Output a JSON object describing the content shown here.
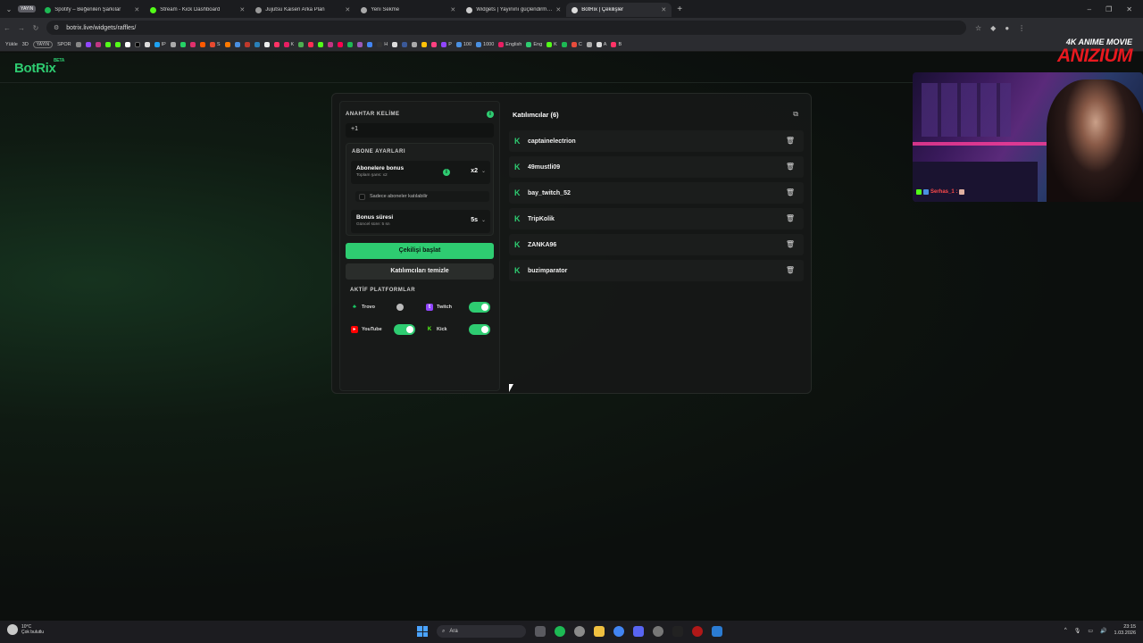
{
  "browser": {
    "tabs": [
      {
        "label": "Spotify – Beğenilen Şarkılar",
        "color": "#1db954",
        "active": false
      },
      {
        "label": "Stream - Kick Dashboard",
        "color": "#53fc18",
        "active": false
      },
      {
        "label": "Jujutsu Kaisen Arka Plan",
        "color": "#999999",
        "active": false
      },
      {
        "label": "Yeni Sekme",
        "color": "#aaaaaa",
        "active": false
      },
      {
        "label": "Widgets | Yayınını güçlendirmek",
        "color": "#cccccc",
        "active": false
      },
      {
        "label": "BotRix | Çekilişler",
        "color": "#dddddd",
        "active": true
      }
    ],
    "tab_group_badge": "YAYIN",
    "url": "botrix.live/widgets/raffles/",
    "bookmarks": [
      {
        "label": "Yükle"
      },
      {
        "label": "3D"
      },
      {
        "label": "YAYIN",
        "pill": true
      },
      {
        "label": "SPOR"
      },
      {
        "label": "IP"
      },
      {
        "label": "S"
      },
      {
        "label": "K"
      },
      {
        "label": "H"
      },
      {
        "label": "P"
      },
      {
        "label": "100"
      },
      {
        "label": "1000"
      },
      {
        "label": "English"
      },
      {
        "label": "Eng"
      },
      {
        "label": "K"
      },
      {
        "label": "C"
      },
      {
        "label": "A"
      },
      {
        "label": "B"
      }
    ]
  },
  "app": {
    "logo": "BotRix",
    "logo_badge": "BETA"
  },
  "settings": {
    "keyword_label": "ANAHTAR KELİME",
    "keyword_value": "+1",
    "subscriber_section": "ABONE AYARLARI",
    "sub_bonus_title": "Abonelere bonus",
    "sub_bonus_desc": "Toplam şans: x2",
    "sub_bonus_value": "x2",
    "sub_only_label": "Sadece aboneler katılabilir",
    "bonus_time_title": "Bonus süresi",
    "bonus_time_desc": "Güncel süre: 5 sn",
    "bonus_time_value": "5s",
    "start_button": "Çekilişi başlat",
    "clear_button": "Katılımcıları temizle",
    "platforms_label": "AKTİF PLATFORMLAR",
    "platforms": [
      {
        "name": "Trovo",
        "enabled": false,
        "color": "#19d66b"
      },
      {
        "name": "Twitch",
        "enabled": true,
        "color": "#9146ff"
      },
      {
        "name": "YouTube",
        "enabled": true,
        "color": "#ff0000"
      },
      {
        "name": "Kick",
        "enabled": true,
        "color": "#53fc18"
      }
    ]
  },
  "participants": {
    "title": "Katılımcılar (6)",
    "list": [
      "captainelectrion",
      "49mustli09",
      "bay_twitch_52",
      "TripKolik",
      "ZANKA96",
      "buzimparator"
    ]
  },
  "overlay": {
    "watermark_top": "4K ANIME MOVIE",
    "watermark_main": "ANIZIUM",
    "chat_text": "Serhas_1 :"
  },
  "taskbar": {
    "weather_temp": "10°C",
    "weather_desc": "Çok bulutlu",
    "search_placeholder": "Ara",
    "time": "23:15",
    "date": "1.03.2026"
  },
  "colors": {
    "accent": "#2ecc71",
    "kick": "#53fc18"
  }
}
